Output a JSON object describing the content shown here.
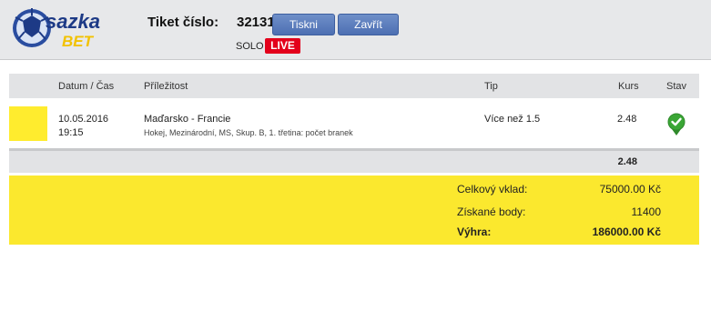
{
  "header": {
    "logo_text": "sazka BET",
    "ticket_label": "Tiket číslo:",
    "ticket_number": "32131",
    "print_button": "Tiskni",
    "close_button": "Zavřít",
    "bet_type": "SOLO",
    "live_badge": "LIVE"
  },
  "table": {
    "columns": [
      "Datum / Čas",
      "Příležitost",
      "Tip",
      "Kurs",
      "Stav"
    ],
    "rows": [
      {
        "date": "10.05.2016",
        "time": "19:15",
        "event": "Maďarsko - Francie",
        "event_detail": "Hokej, Mezinárodní, MS, Skup. B, 1. třetina: počet branek",
        "tip": "Více než 1.5",
        "odds": "2.48",
        "status_icon": "check-circle-icon"
      }
    ],
    "total_odds": "2.48"
  },
  "summary": {
    "stake_label": "Celkový vklad:",
    "stake_value": "75000.00 Kč",
    "points_label": "Získané body:",
    "points_value": "11400",
    "win_label": "Výhra:",
    "win_value": "186000.00 Kč"
  },
  "colors": {
    "accent_yellow": "#fbe82e",
    "live_red": "#e3001b",
    "button_blue": "#5a7bbd",
    "status_green": "#3aa635"
  }
}
